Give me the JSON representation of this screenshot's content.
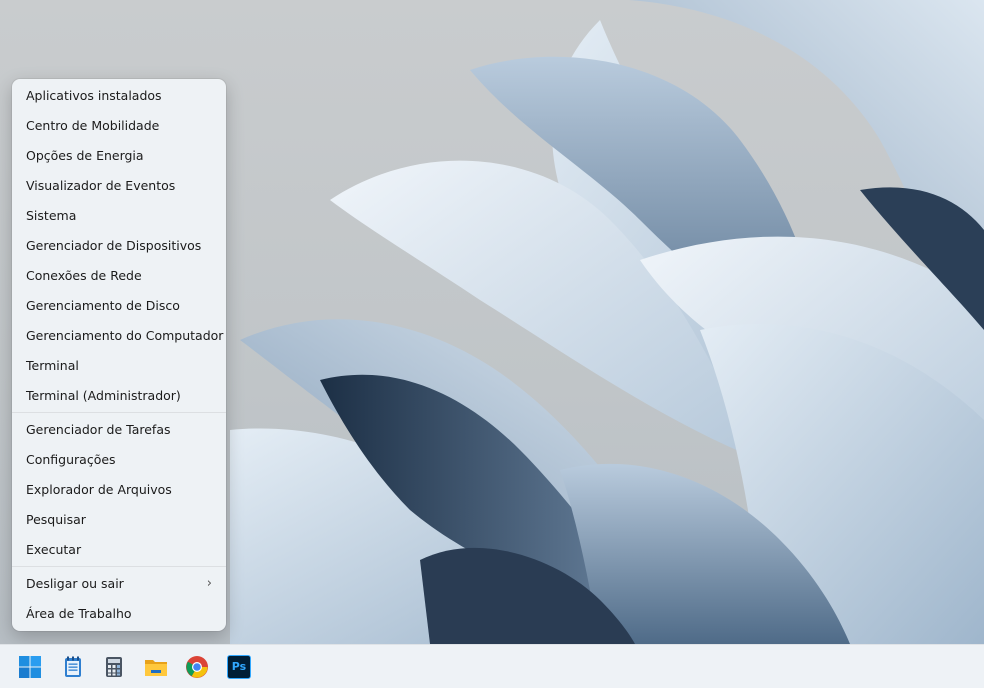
{
  "wallpaper": {
    "accent_light": "#e3ecf4",
    "accent_mid": "#8fa7bf",
    "accent_dark": "#1d3147"
  },
  "context_menu": {
    "group1": [
      {
        "id": "installed-apps",
        "label": "Aplicativos instalados"
      },
      {
        "id": "mobility-center",
        "label": "Centro de Mobilidade"
      },
      {
        "id": "power-options",
        "label": "Opções de Energia"
      },
      {
        "id": "event-viewer",
        "label": "Visualizador de Eventos"
      },
      {
        "id": "system",
        "label": "Sistema"
      },
      {
        "id": "device-manager",
        "label": "Gerenciador de Dispositivos"
      },
      {
        "id": "network-connections",
        "label": "Conexões de Rede"
      },
      {
        "id": "disk-management",
        "label": "Gerenciamento de Disco"
      },
      {
        "id": "computer-management",
        "label": "Gerenciamento do Computador"
      },
      {
        "id": "terminal",
        "label": "Terminal"
      },
      {
        "id": "terminal-admin",
        "label": "Terminal (Administrador)"
      }
    ],
    "group2": [
      {
        "id": "task-manager",
        "label": "Gerenciador de Tarefas"
      },
      {
        "id": "settings",
        "label": "Configurações"
      },
      {
        "id": "file-explorer",
        "label": "Explorador de Arquivos"
      },
      {
        "id": "search",
        "label": "Pesquisar"
      },
      {
        "id": "run",
        "label": "Executar"
      }
    ],
    "group3": [
      {
        "id": "shutdown",
        "label": "Desligar ou sair",
        "submenu_icon": "chevron-right-icon"
      },
      {
        "id": "desktop",
        "label": "Área de Trabalho"
      }
    ]
  },
  "taskbar": {
    "icons": [
      "windows-start-icon",
      "notepad-icon",
      "calculator-icon",
      "file-explorer-icon",
      "chrome-icon",
      "photoshop-icon"
    ],
    "photoshop_label": "Ps"
  }
}
